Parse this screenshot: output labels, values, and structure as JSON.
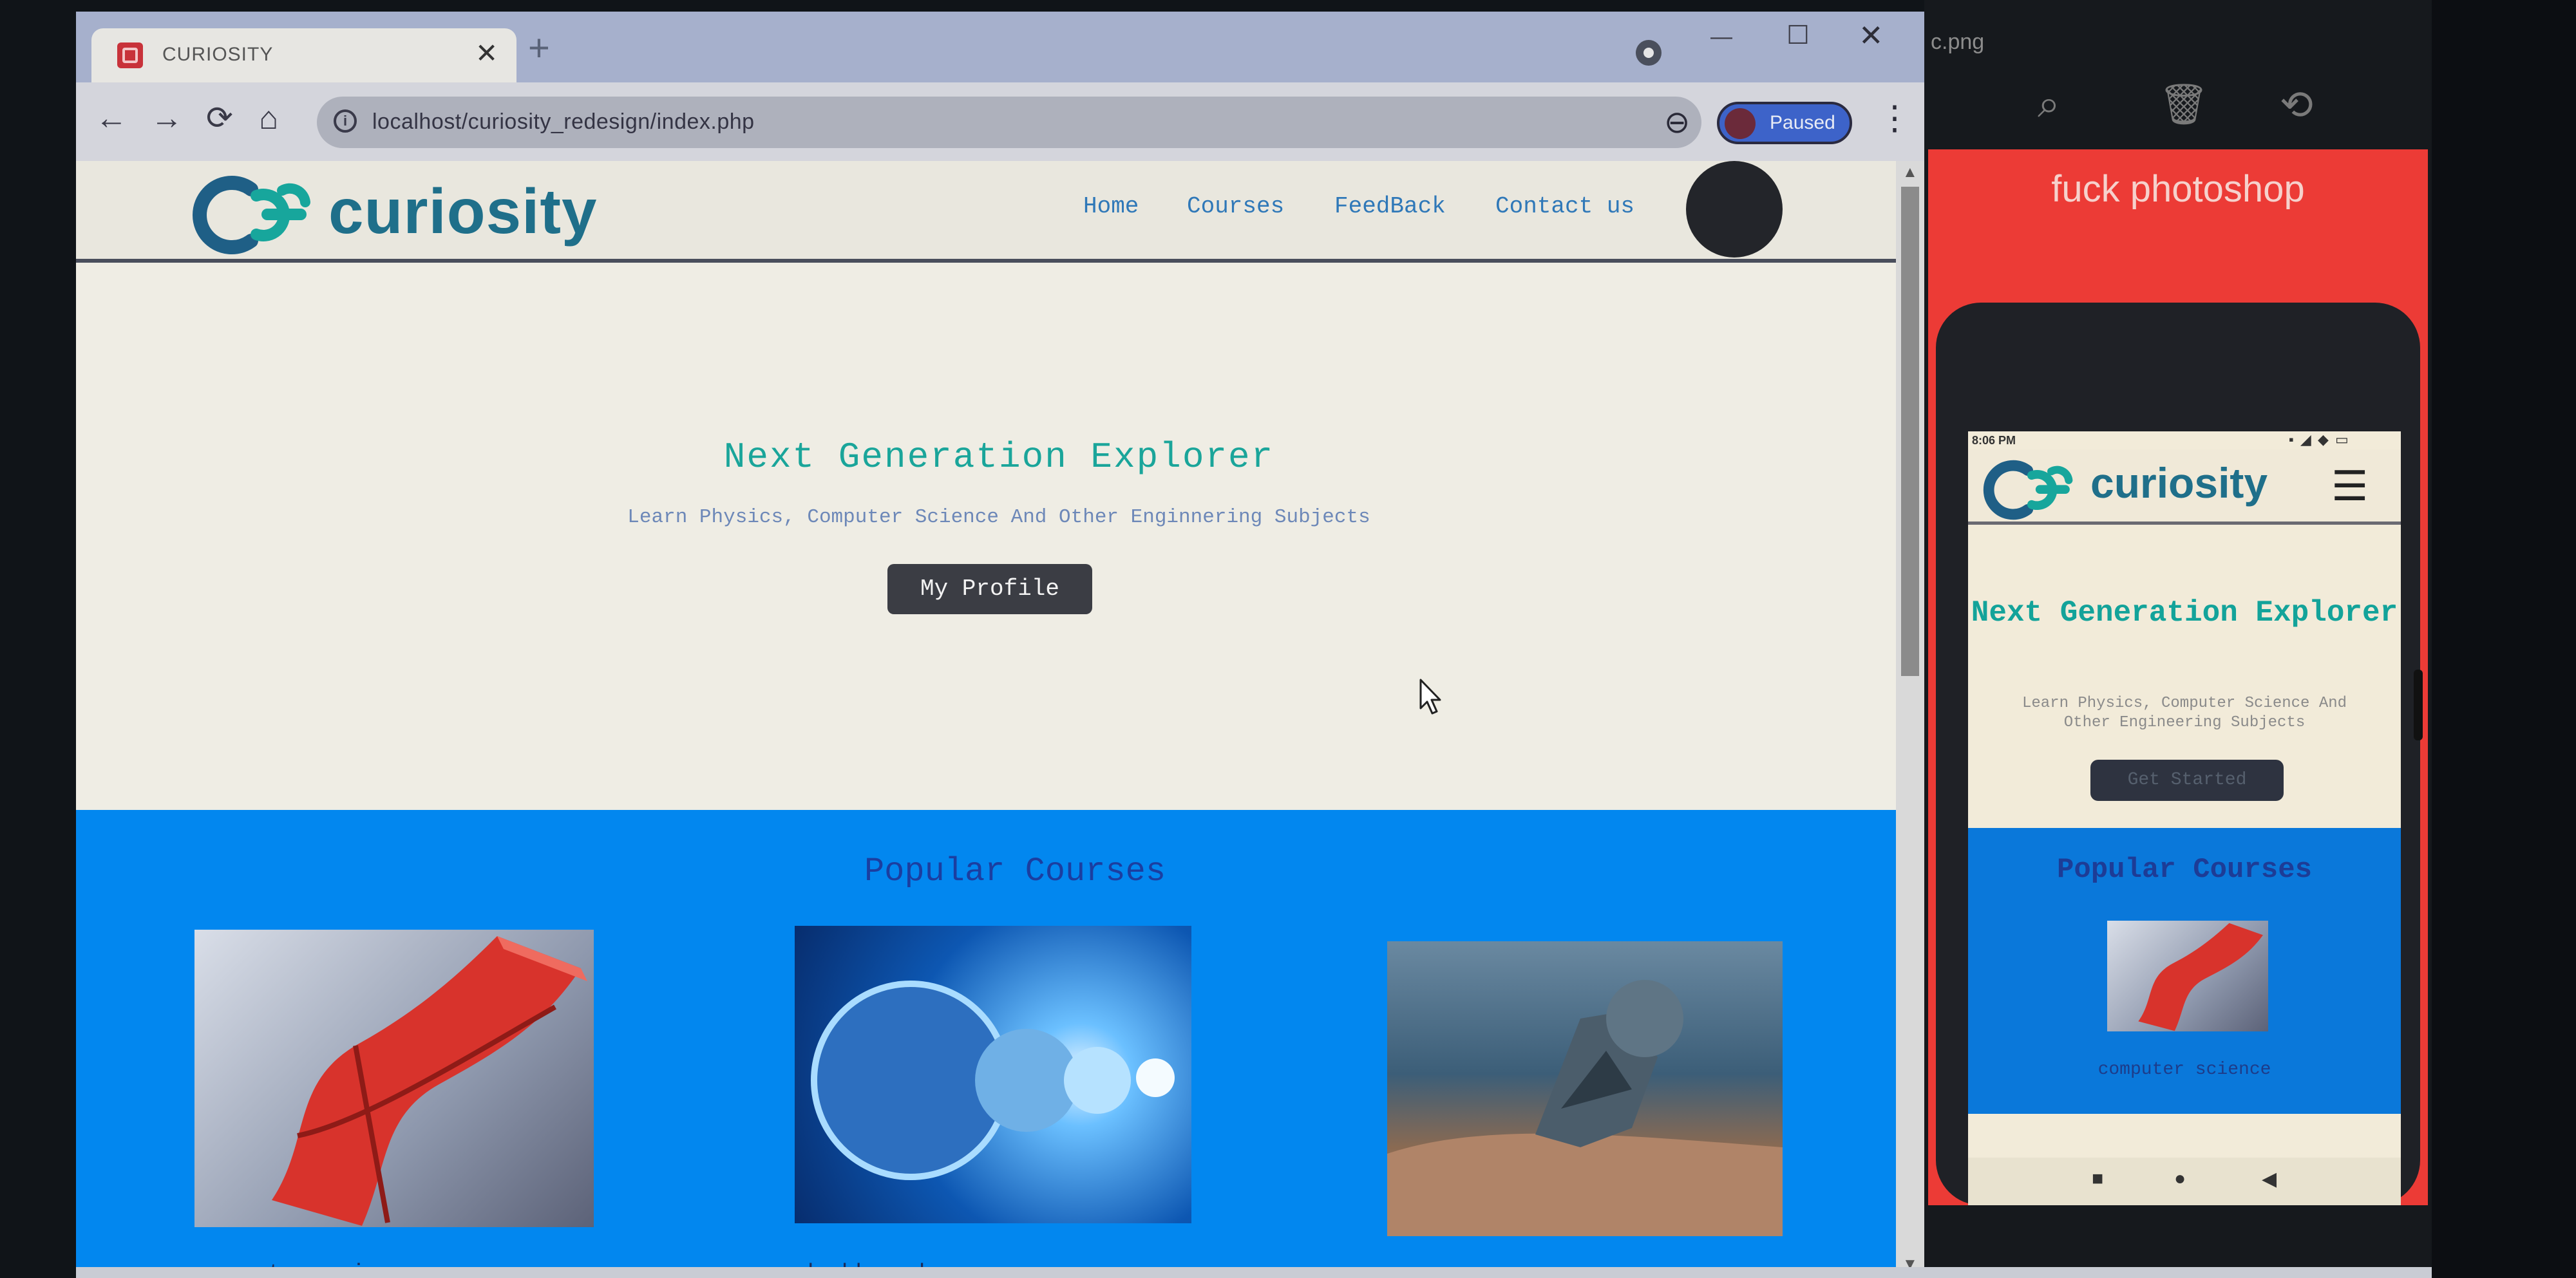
{
  "browser": {
    "tab_title": "CURIOSITY",
    "tab_close": "✕",
    "new_tab": "+",
    "window_min": "—",
    "window_max": "☐",
    "window_close": "✕",
    "url": "localhost/curiosity_redesign/index.php",
    "profile_status": "Paused",
    "icons": {
      "back": "←",
      "forward": "→",
      "reload": "⟳",
      "home": "⌂",
      "zoom": "⊖",
      "star": "☆",
      "menu": "⋮",
      "info": "i"
    }
  },
  "site": {
    "logo_text": "curiosity",
    "nav": [
      "Home",
      "Courses",
      "FeedBack",
      "Contact us"
    ],
    "hero": {
      "title": "Next Generation Explorer",
      "subtitle": "Learn Physics, Computer Science And Other Enginnering Subjects",
      "button": "My Profile"
    },
    "courses": {
      "title": "Popular Courses",
      "items": [
        {
          "label": "computer science",
          "image": "windows-wave"
        },
        {
          "label": "dashboard",
          "image": "planets"
        },
        {
          "label": "",
          "image": "underwater-sculpture"
        }
      ]
    }
  },
  "viewer": {
    "title": "c.png",
    "caption": "fuck photoshop",
    "tools": [
      "zoom-in",
      "delete",
      "rotate"
    ],
    "phone": {
      "time": "8:06 PM",
      "status_icons": "▪ ◢ ◆ ▭",
      "logo_text": "curiosity",
      "menu_icon": "☰",
      "hero_title": "Next Generation Explorer",
      "hero_subtitle": "Learn Physics, Computer Science And Other Engineering Subjects",
      "hero_button": "Get Started",
      "courses_title": "Popular Courses",
      "course_label": "computer science",
      "nav": [
        "■",
        "●",
        "◀"
      ]
    }
  },
  "colors": {
    "accent_teal": "#1aa59a",
    "courses_blue": "#0287ef",
    "logo_blue": "#1f6f8a",
    "red_panel": "#ec3b36"
  }
}
